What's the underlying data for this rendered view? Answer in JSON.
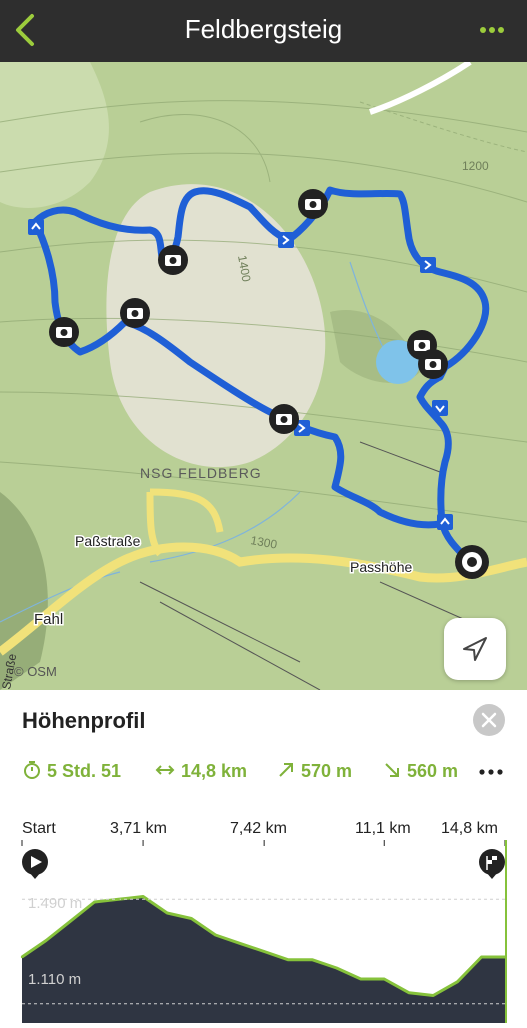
{
  "header": {
    "title": "Feldbergsteig",
    "back_icon": "chevron-left-icon",
    "menu_icon": "more-dots-icon",
    "accent": "#9ccc3c",
    "background": "#2e2e2e"
  },
  "map": {
    "labels": {
      "region": "NSG FELDBERG",
      "street": "Paßstraße",
      "pass": "Passhöhe",
      "village": "Fahl",
      "contour_1200": "1200",
      "contour_1400": "1400",
      "contour_1300": "1300",
      "edge_fragment": "Straße"
    },
    "attribution": "© OSM",
    "route_color": "#1f5fd6",
    "locate_icon": "navigation-arrow-icon"
  },
  "profile_panel": {
    "title": "Höhenprofil",
    "close_icon": "close-icon",
    "stats": {
      "duration": "5 Std. 51",
      "distance": "14,8 km",
      "ascent": "570 m",
      "descent": "560 m"
    },
    "stat_color": "#7fb23a",
    "more_icon": "more-dots-icon",
    "axis_ticks": [
      "Start",
      "3,71 km",
      "7,42 km",
      "11,1 km",
      "14,8 km"
    ],
    "altitude_labels": [
      "1.490 m",
      "1.110 m"
    ],
    "start_icon": "play-marker-icon",
    "finish_icon": "finish-flag-icon"
  },
  "chart_data": {
    "type": "area",
    "xlabel": "",
    "ylabel": "",
    "x": [
      0,
      0.74,
      1.48,
      2.22,
      2.96,
      3.71,
      4.45,
      5.19,
      5.93,
      6.67,
      7.42,
      8.16,
      8.9,
      9.64,
      10.38,
      11.1,
      11.86,
      12.6,
      13.34,
      14.08,
      14.8
    ],
    "y": [
      1280,
      1340,
      1410,
      1480,
      1490,
      1500,
      1440,
      1420,
      1360,
      1330,
      1300,
      1270,
      1270,
      1240,
      1200,
      1200,
      1150,
      1140,
      1190,
      1280,
      1280
    ],
    "ylim": [
      1040,
      1560
    ],
    "y_ticks": [
      1110,
      1490
    ],
    "x_ticks": [
      0,
      3.71,
      7.42,
      11.1,
      14.8
    ],
    "grid": true
  }
}
